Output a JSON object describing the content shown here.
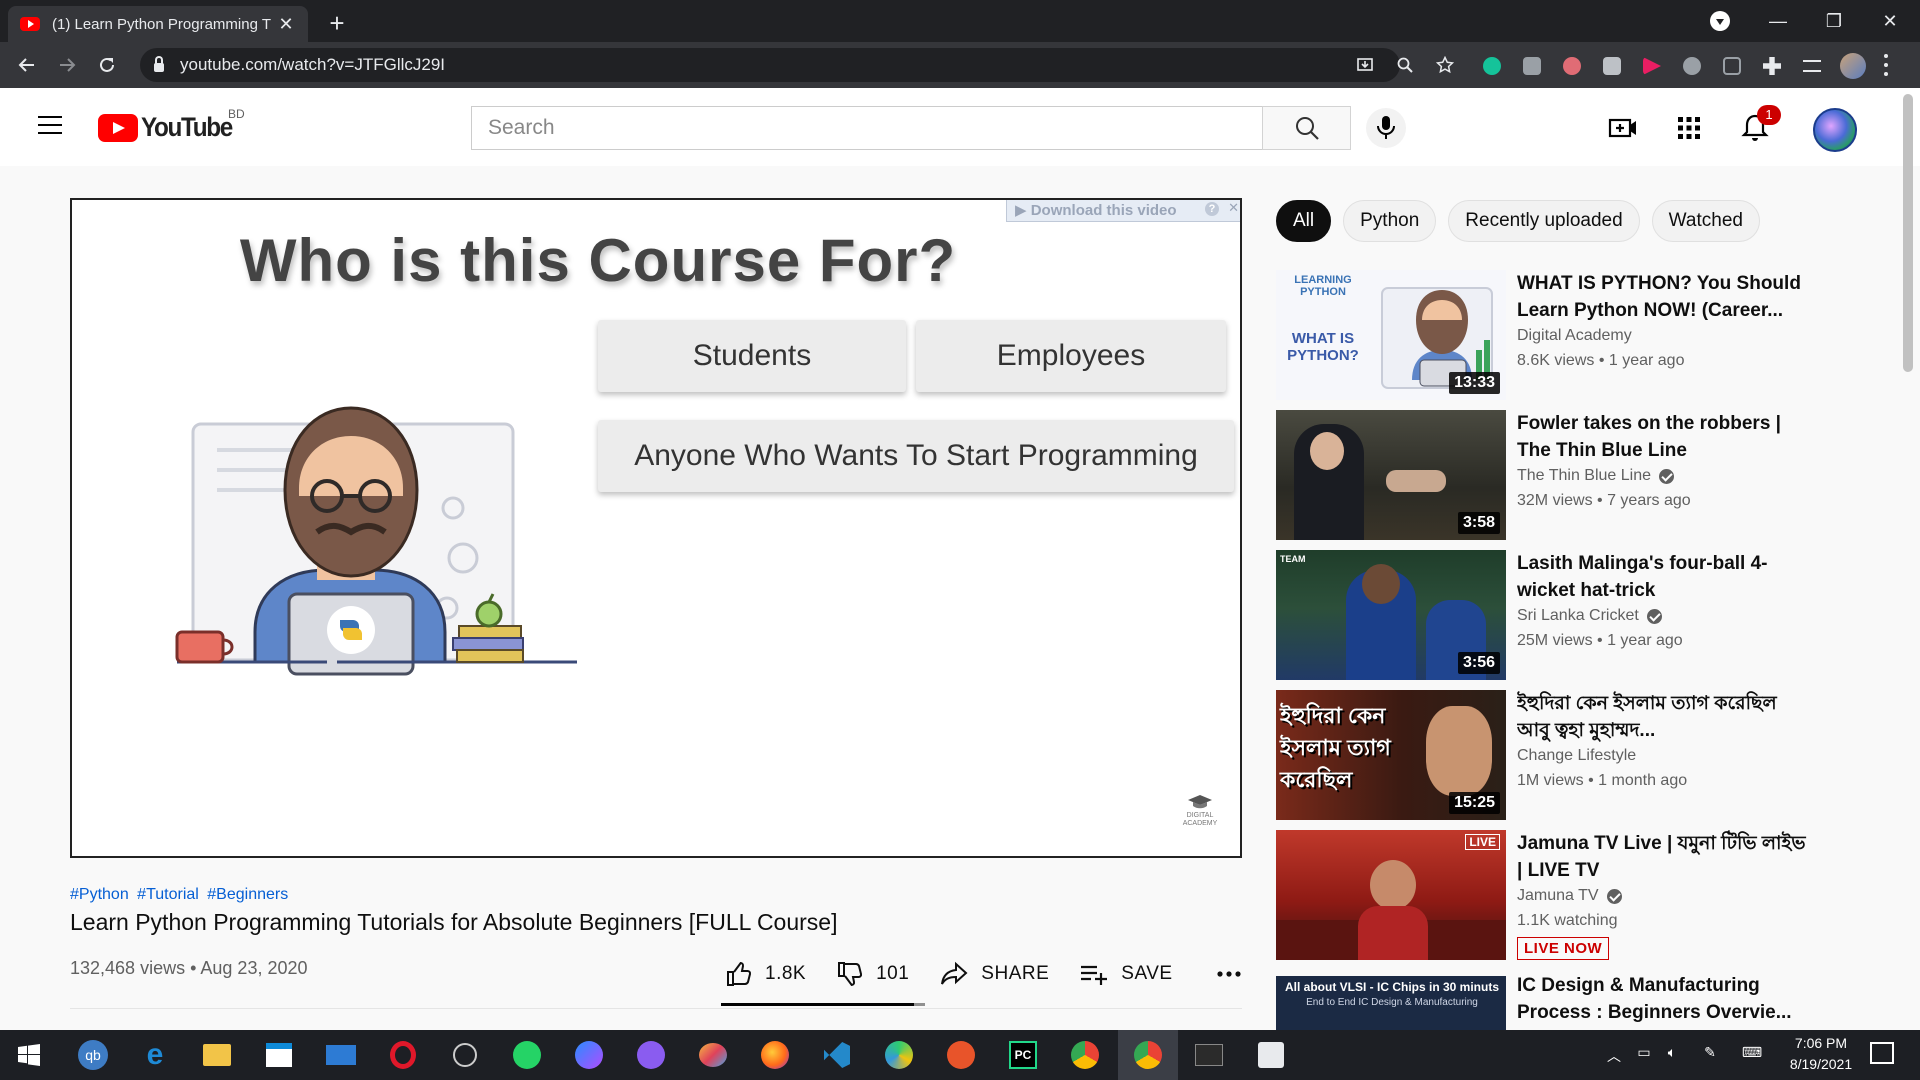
{
  "browser": {
    "tab_title": "(1) Learn Python Programming T",
    "url": "youtube.com/watch?v=JTFGllcJ29I"
  },
  "header": {
    "logo_text": "YouTube",
    "country_code": "BD",
    "search_placeholder": "Search",
    "notification_count": "1"
  },
  "player": {
    "download_label": "▶ Download this video",
    "slide": {
      "title": "Who is this Course For?",
      "items": [
        "Students",
        "Employees",
        "Anyone Who Wants To Start Programming"
      ],
      "watermark": "DIGITAL ACADEMY"
    }
  },
  "video": {
    "hashtags": [
      "#Python",
      "#Tutorial",
      "#Beginners"
    ],
    "title": "Learn Python Programming Tutorials for Absolute Beginners [FULL Course]",
    "views": "132,468 views",
    "date": "Aug 23, 2020",
    "likes": "1.8K",
    "dislikes": "101",
    "share_label": "SHARE",
    "save_label": "SAVE",
    "like_ratio": 0.947
  },
  "chips": [
    "All",
    "Python",
    "Recently uploaded",
    "Watched"
  ],
  "recommendations": [
    {
      "title": "WHAT IS PYTHON? You Should Learn Python NOW! (Career...",
      "channel": "Digital Academy",
      "verified": false,
      "meta": "8.6K views • 1 year ago",
      "duration": "13:33"
    },
    {
      "title": "Fowler takes on the robbers | The Thin Blue Line",
      "channel": "The Thin Blue Line",
      "verified": true,
      "meta": "32M views • 7 years ago",
      "duration": "3:58"
    },
    {
      "title": "Lasith Malinga's four-ball 4-wicket hat-trick",
      "channel": "Sri Lanka Cricket",
      "verified": true,
      "meta": "25M views • 1 year ago",
      "duration": "3:56"
    },
    {
      "title": "ইহুদিরা কেন ইসলাম ত্যাগ করেছিল আবু ত্বহা মুহাম্মদ...",
      "channel": "Change Lifestyle",
      "verified": false,
      "meta": "1M views • 1 month ago",
      "duration": "15:25"
    },
    {
      "title": "Jamuna TV Live | যমুনা টিভি লাইভ | LIVE TV",
      "channel": "Jamuna TV",
      "verified": true,
      "meta": "1.1K watching",
      "live_badge": "LIVE NOW",
      "live_tag": "LIVE"
    },
    {
      "title": "IC Design & Manufacturing Process : Beginners Overvie...",
      "thumb_text": "All about VLSI - IC Chips in 30 minuts",
      "thumb_sub": "End to End IC Design & Manufacturing"
    }
  ],
  "thumb_text": {
    "python_badge": "LEARNING PYTHON",
    "python_q": "WHAT IS PYTHON?",
    "bangla_overlay": "ইহুদিরা কেন ইসলাম ত্যাগ করেছিল",
    "team_logo": "TEAM"
  },
  "system_tray": {
    "time": "7:06 PM",
    "date": "8/19/2021",
    "pycharm_label": "PC"
  }
}
